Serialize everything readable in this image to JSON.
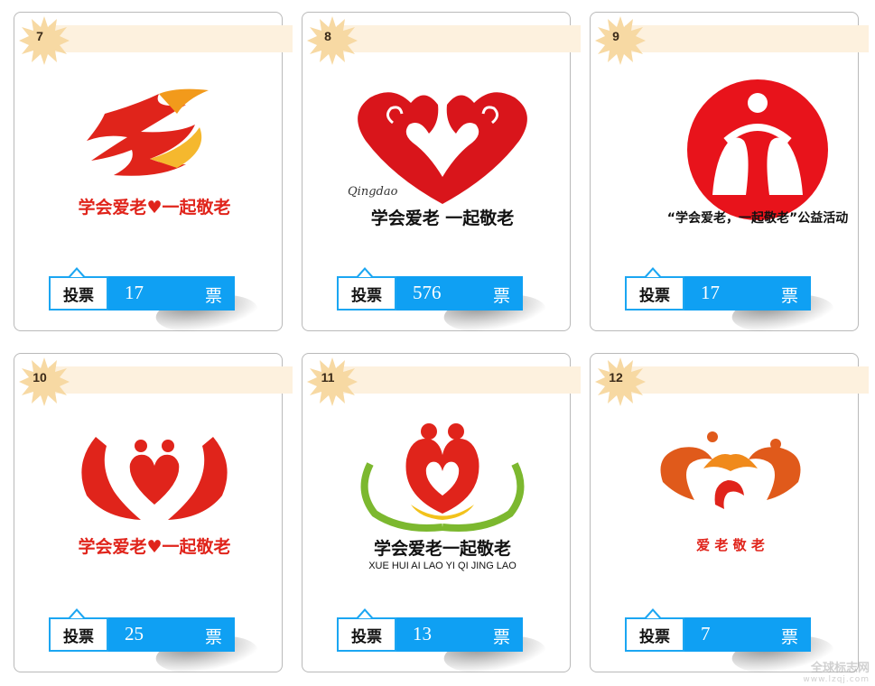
{
  "vote_label": "投票",
  "vote_unit": "票",
  "entries": [
    {
      "number": "7",
      "votes": "17",
      "logo_text": "学会爱老♥一起敬老",
      "logo_subtext": ""
    },
    {
      "number": "8",
      "votes": "576",
      "logo_text": "学会爱老 一起敬老",
      "logo_subtext": "Qingdao"
    },
    {
      "number": "9",
      "votes": "17",
      "logo_text": "“学会爱老，一起敬老”公益活动",
      "logo_subtext": ""
    },
    {
      "number": "10",
      "votes": "25",
      "logo_text": "学会爱老♥一起敬老",
      "logo_subtext": ""
    },
    {
      "number": "11",
      "votes": "13",
      "logo_text": "学会爱老一起敬老",
      "logo_subtext": "XUE HUI AI LAO YI QI JING LAO"
    },
    {
      "number": "12",
      "votes": "7",
      "logo_text": "爱 老 敬 老",
      "logo_subtext": ""
    }
  ],
  "watermark": {
    "line1": "全球标志网",
    "line2": "www.lzqj.com"
  },
  "colors": {
    "accent_blue": "#0fa0f3",
    "logo_red": "#e0241b",
    "band": "#fdf1de",
    "star": "#f7d9a3"
  }
}
